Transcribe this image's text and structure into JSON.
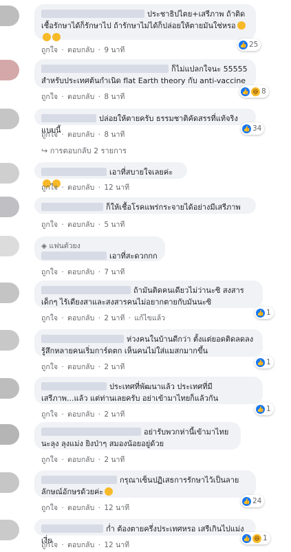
{
  "labels": {
    "like": "ถูกใจ",
    "reply": "ตอบกลับ",
    "sep": "·",
    "edited": "แก้ไขแล้ว"
  },
  "comments": [
    {
      "text": "ประชาธิปไตย+เสรีภาพ ถ้าติดเชื้อรักษาได้ก็รักษาไป ถ้ารักษาไม่ได้ก็ปล่อยให้ตายมันใช่หรอ",
      "time": "9 นาที",
      "count": "25"
    },
    {
      "text": "ก็ไม่แปลกใจนะ 55555 สำหรับประเทศต้นกำเนิด flat Earth theory กับ anti-vaccine",
      "time": "8 นาที",
      "count": "8"
    },
    {
      "text": "ปล่อยให้ตายครับ ธรรมชาติคัดสรรที่แท้จริงแบบนี้",
      "time": "8 นาที",
      "count": "34"
    },
    {
      "text": "เอาที่สบายใจเลยค่ะ",
      "time": "12 นาที"
    },
    {
      "text": "ก็ให้เชื้อโรคแพร่กระจายได้อย่างมีเสรีภาพ",
      "time": "5 นาที"
    },
    {
      "text": "เอาที่สะดวกกก",
      "time": "7 นาที"
    },
    {
      "text": "ถ้ามันติดคนเดียวไม่ว่านะซิ สงสารเด็กๆ ไร้เดียงสาและสงสารคนไม่อยากตายกับมันนะซิ",
      "time": "2 นาที",
      "count": "1"
    },
    {
      "text": "ห่วงคนในบ้านดีกว่า ตั้งแต่ยอดติดลดลง รู้สึกหลายคนเริ่มการ์ดตก เห็นคนไม่ใส่แมสกมากขึ้น",
      "time": "2 นาที",
      "count": "1"
    },
    {
      "text": "ประเทศที่พัฒนาแล้ว ประเทศที่มีเสรีภาพ...แล้ว แต่ท่านเลยครับ อย่าเข้ามาไทยก็แล้วกัน",
      "time": "2 นาที",
      "count": "1"
    },
    {
      "text": "อย่ารับพวกห่านี้เข้ามาไทยนะลุง ลุงแม่ง ยิงป่าๆ สมองน้อยอยู่ด้วย",
      "time": "2 นาที"
    },
    {
      "text": "กรุณาเซ็นปฏิเสธการรักษาไว้เป็นลายลักษณ์อักษรด้วยค่ะ",
      "time": "12 นาที",
      "count": "24"
    },
    {
      "text": "ก่ำ ต้องตายครึ่งประเทศหรอ เสรีเกินไปแม่งเงี่ย",
      "time": "12 นาที",
      "count": "1"
    }
  ],
  "replies_link": "การตอบกลับ 2 รายการ",
  "fan_badge": "แฟนตัวยง"
}
